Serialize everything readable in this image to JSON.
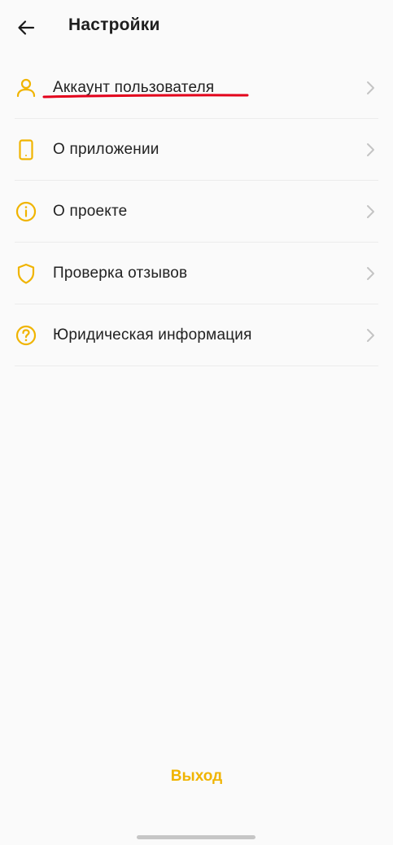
{
  "header": {
    "title": "Настройки",
    "back_icon": "arrow-left-icon"
  },
  "menu": {
    "items": [
      {
        "label": "Аккаунт пользователя",
        "icon": "user-icon"
      },
      {
        "label": "О приложении",
        "icon": "phone-icon"
      },
      {
        "label": "О проекте",
        "icon": "info-icon"
      },
      {
        "label": "Проверка отзывов",
        "icon": "shield-icon"
      },
      {
        "label": "Юридическая информация",
        "icon": "help-icon"
      }
    ]
  },
  "logout": {
    "label": "Выход"
  },
  "colors": {
    "accent": "#f0b400",
    "annotation": "#e3001b",
    "chevron": "#c4c4c4",
    "background": "#fafafa"
  }
}
